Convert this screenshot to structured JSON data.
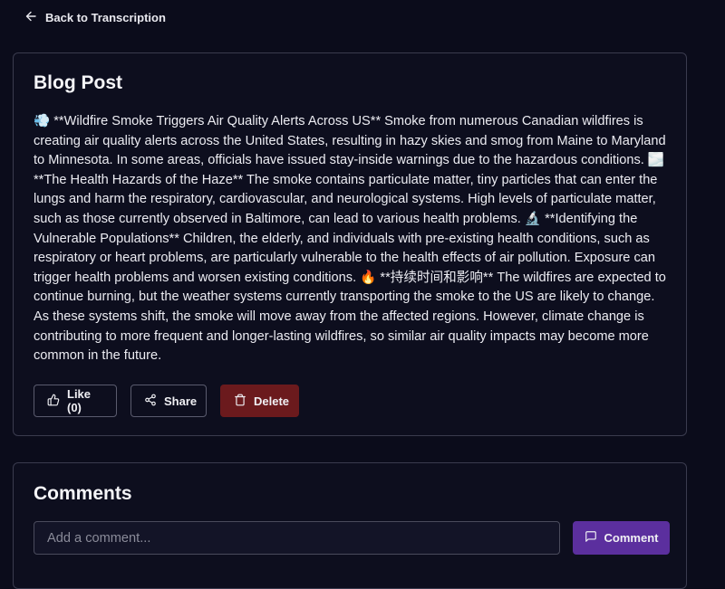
{
  "nav": {
    "back_label": "Back to Transcription"
  },
  "post": {
    "heading": "Blog Post",
    "body": "💨 **Wildfire Smoke Triggers Air Quality Alerts Across US** Smoke from numerous Canadian wildfires is creating air quality alerts across the United States, resulting in hazy skies and smog from Maine to Maryland to Minnesota. In some areas, officials have issued stay-inside warnings due to the hazardous conditions. 🌫️ **The Health Hazards of the Haze** The smoke contains particulate matter, tiny particles that can enter the lungs and harm the respiratory, cardiovascular, and neurological systems. High levels of particulate matter, such as those currently observed in Baltimore, can lead to various health problems. 🔬 **Identifying the Vulnerable Populations** Children, the elderly, and individuals with pre-existing health conditions, such as respiratory or heart problems, are particularly vulnerable to the health effects of air pollution. Exposure can trigger health problems and worsen existing conditions. 🔥 **持续时间和影响** The wildfires are expected to continue burning, but the weather systems currently transporting the smoke to the US are likely to change. As these systems shift, the smoke will move away from the affected regions. However, climate change is contributing to more frequent and longer-lasting wildfires, so similar air quality impacts may become more common in the future.",
    "like_label": "Like (0)",
    "share_label": "Share",
    "delete_label": "Delete"
  },
  "comments": {
    "heading": "Comments",
    "input_placeholder": "Add a comment...",
    "input_value": "",
    "submit_label": "Comment"
  },
  "icons": {
    "back": "arrow-left-icon",
    "like": "thumbs-up-icon",
    "share": "share-icon",
    "delete": "trash-icon",
    "comment": "message-square-icon"
  },
  "colors": {
    "background": "#0b0c1b",
    "delete": "#6b1a1d",
    "accent": "#5b2f9e"
  }
}
